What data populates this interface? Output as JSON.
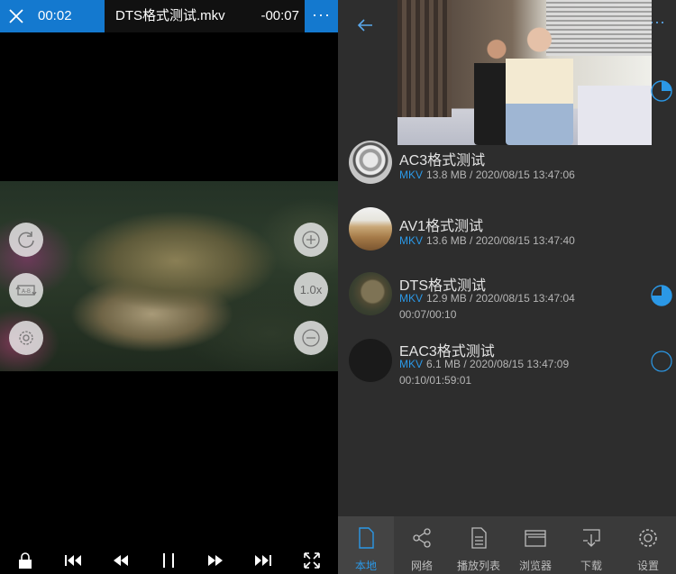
{
  "player": {
    "current_time": "00:02",
    "title": "DTS格式测试.mkv",
    "remaining_time": "-00:07",
    "more_label": "···",
    "speed_label": "1.0x"
  },
  "library": {
    "more_label": "···",
    "items": [
      {
        "title": "AC3格式测试",
        "format": "MKV",
        "meta": "13.8 MB / 2020/08/15 13:47:06",
        "progress_text": ""
      },
      {
        "title": "AV1格式测试",
        "format": "MKV",
        "meta": "13.6 MB / 2020/08/15 13:47:40",
        "progress_text": ""
      },
      {
        "title": "DTS格式测试",
        "format": "MKV",
        "meta": "12.9 MB / 2020/08/15 13:47:04",
        "progress_text": "00:07/00:10",
        "watched_fraction": 0.75
      },
      {
        "title": "EAC3格式测试",
        "format": "MKV",
        "meta": "6.1 MB / 2020/08/15 13:47:09",
        "progress_text": "00:10/01:59:01",
        "watched_fraction": 0.0
      }
    ],
    "first_item_watched_fraction": 0.25,
    "tabs": [
      {
        "label": "本地",
        "icon": "file-icon"
      },
      {
        "label": "网络",
        "icon": "share-icon"
      },
      {
        "label": "播放列表",
        "icon": "playlist-icon"
      },
      {
        "label": "浏览器",
        "icon": "browser-icon"
      },
      {
        "label": "下载",
        "icon": "download-icon"
      },
      {
        "label": "设置",
        "icon": "settings-icon"
      }
    ]
  },
  "colors": {
    "accent": "#1479cf",
    "accent_text": "#2b98e6",
    "list_bg": "#2d2d2d",
    "tabbar_bg": "#3a3a3a"
  }
}
